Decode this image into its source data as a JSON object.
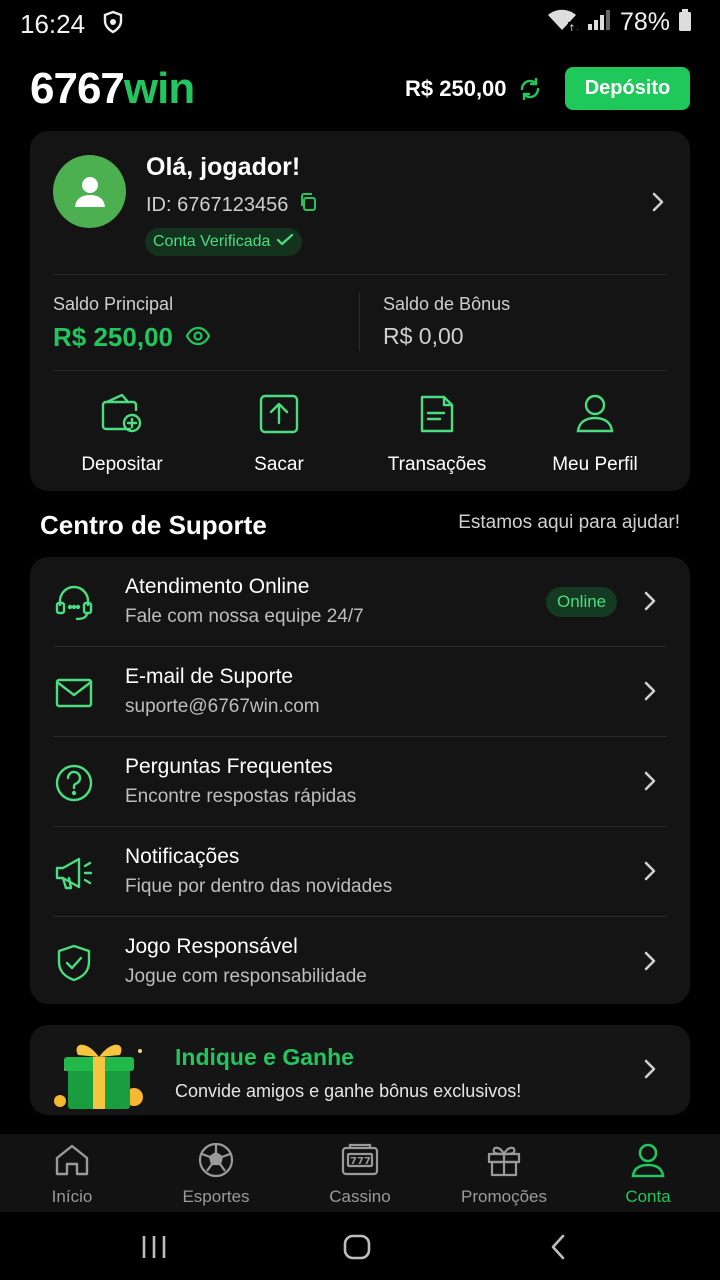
{
  "status": {
    "time": "16:24",
    "battery": "78%"
  },
  "header": {
    "logo_part1": "6767",
    "logo_part2": "win",
    "balance": "R$ 250,00",
    "deposit_label": "Depósito"
  },
  "profile": {
    "greeting": "Olá, jogador!",
    "id_label": "ID: 6767123456",
    "verified_label": "Conta Verificada",
    "main_balance_label": "Saldo Principal",
    "main_balance": "R$ 250,00",
    "bonus_balance_label": "Saldo de Bônus",
    "bonus_balance": "R$ 0,00",
    "actions": [
      {
        "label": "Depositar",
        "icon": "wallet-plus-icon"
      },
      {
        "label": "Sacar",
        "icon": "upload-icon"
      },
      {
        "label": "Transações",
        "icon": "receipt-icon"
      },
      {
        "label": "Meu Perfil",
        "icon": "user-icon"
      }
    ]
  },
  "support": {
    "title": "Centro de Suporte",
    "subtitle": "Estamos aqui para ajudar!",
    "items": [
      {
        "title": "Atendimento Online",
        "subtitle": "Fale com nossa equipe 24/7",
        "icon": "headset-icon",
        "badge": "Online"
      },
      {
        "title": "E-mail de Suporte",
        "subtitle": "suporte@6767win.com",
        "icon": "mail-icon"
      },
      {
        "title": "Perguntas Frequentes",
        "subtitle": "Encontre respostas rápidas",
        "icon": "question-icon"
      },
      {
        "title": "Notificações",
        "subtitle": "Fique por dentro das novidades",
        "icon": "megaphone-icon"
      },
      {
        "title": "Jogo Responsável",
        "subtitle": "Jogue com responsabilidade",
        "icon": "shield-check-icon"
      }
    ]
  },
  "referral": {
    "title": "Indique e Ganhe",
    "subtitle": "Convide amigos e ganhe bônus exclusivos!"
  },
  "bottom_nav": {
    "items": [
      {
        "label": "Início",
        "icon": "home-icon"
      },
      {
        "label": "Esportes",
        "icon": "soccer-ball-icon"
      },
      {
        "label": "Cassino",
        "icon": "slot-machine-icon"
      },
      {
        "label": "Promoções",
        "icon": "gift-icon"
      },
      {
        "label": "Conta",
        "icon": "user-icon"
      }
    ],
    "active": "Conta"
  },
  "colors": {
    "accent": "#22c55e",
    "background": "#000000",
    "card": "#141414"
  }
}
